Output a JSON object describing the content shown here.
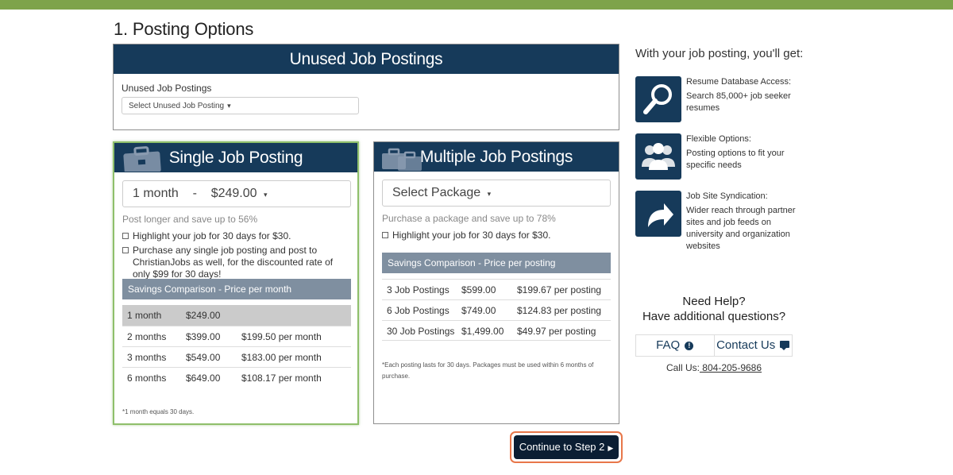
{
  "page_title": "1. Posting Options",
  "unused": {
    "header": "Unused Job Postings",
    "label": "Unused Job Postings",
    "select_value": "Select Unused Job Posting"
  },
  "single": {
    "header": "Single Job Posting",
    "select_duration": "1 month",
    "select_sep": "-",
    "select_price": "$249.00",
    "note": "Post longer and save up to 56%",
    "check1": "Highlight your job for 30 days for $30.",
    "check2": "Purchase any single job posting and post to ChristianJobs as well, for the discounted rate of only $99 for 30 days!",
    "savings_title": "Savings Comparison - Price per month",
    "rows": [
      {
        "term": "1 month",
        "price": "$249.00",
        "per": ""
      },
      {
        "term": "2 months",
        "price": "$399.00",
        "per": "$199.50 per month"
      },
      {
        "term": "3 months",
        "price": "$549.00",
        "per": "$183.00 per month"
      },
      {
        "term": "6 months",
        "price": "$649.00",
        "per": "$108.17 per month"
      }
    ],
    "footnote": "*1 month equals 30 days."
  },
  "multi": {
    "header": "Multiple Job Postings",
    "select_value": "Select Package",
    "note": "Purchase a package and save up to 78%",
    "check1": "Highlight your job for 30 days for $30.",
    "savings_title": "Savings Comparison - Price per posting",
    "rows": [
      {
        "term": "3 Job Postings",
        "price": "$599.00",
        "per": "$199.67 per posting"
      },
      {
        "term": "6 Job Postings",
        "price": "$749.00",
        "per": "$124.83 per posting"
      },
      {
        "term": "30 Job Postings",
        "price": "$1,499.00",
        "per": "$49.97 per posting"
      }
    ],
    "footnote": "*Each posting lasts for 30 days. Packages must be used within 6 months of purchase."
  },
  "continue_label": "Continue to Step 2",
  "sidebar": {
    "heading": "With your job posting, you'll get:",
    "features": [
      {
        "icon": "magnifier-icon",
        "title": "Resume Database Access:",
        "desc": "Search 85,000+ job seeker resumes"
      },
      {
        "icon": "people-icon",
        "title": "Flexible Options:",
        "desc": "Posting options to fit your specific needs"
      },
      {
        "icon": "share-arrow-icon",
        "title": "Job Site Syndication:",
        "desc": "Wider reach through partner sites and job feeds on university and organization websites"
      }
    ],
    "help_line1": "Need Help?",
    "help_line2": "Have additional questions?",
    "faq_label": "FAQ",
    "contact_label": "Contact Us",
    "call_label": "Call Us:",
    "phone": " 804-205-9686"
  },
  "colors": {
    "top_bar": "#7ea34b",
    "header_navy": "#163a5a",
    "savings_bar": "#7f8fa0",
    "button_dark": "#0b1e33",
    "button_outline": "#e8774a",
    "single_border": "#8fbf6b"
  }
}
